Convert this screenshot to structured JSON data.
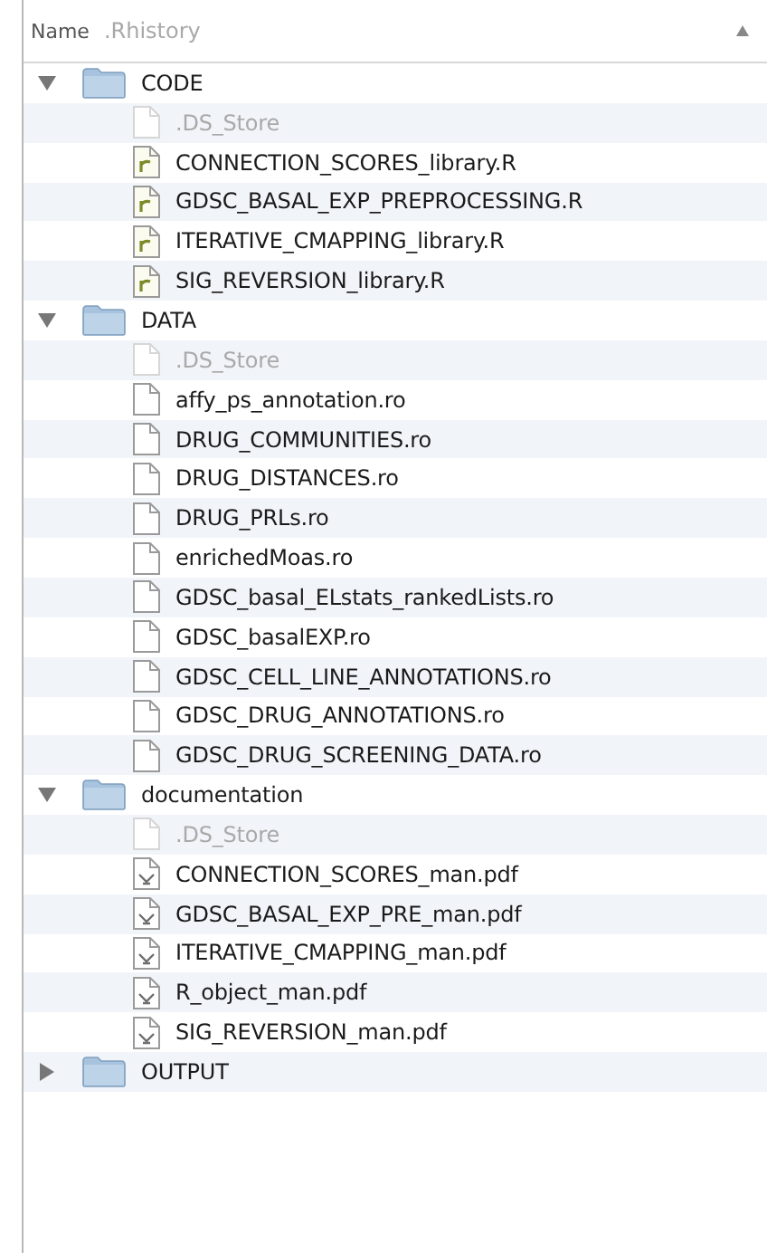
{
  "header": {
    "column": "Name",
    "ghost": ".Rhistory"
  },
  "tree": [
    {
      "name": "CODE",
      "kind": "folder",
      "expanded": true,
      "dimmed": false,
      "children": [
        {
          "name": ".DS_Store",
          "kind": "blank",
          "dimmed": true
        },
        {
          "name": "CONNECTION_SCORES_library.R",
          "kind": "r-script",
          "dimmed": false
        },
        {
          "name": "GDSC_BASAL_EXP_PREPROCESSING.R",
          "kind": "r-script",
          "dimmed": false
        },
        {
          "name": "ITERATIVE_CMAPPING_library.R",
          "kind": "r-script",
          "dimmed": false
        },
        {
          "name": "SIG_REVERSION_library.R",
          "kind": "r-script",
          "dimmed": false
        }
      ]
    },
    {
      "name": "DATA",
      "kind": "folder",
      "expanded": true,
      "dimmed": false,
      "children": [
        {
          "name": ".DS_Store",
          "kind": "blank",
          "dimmed": true
        },
        {
          "name": "affy_ps_annotation.ro",
          "kind": "blank",
          "dimmed": false
        },
        {
          "name": "DRUG_COMMUNITIES.ro",
          "kind": "blank",
          "dimmed": false
        },
        {
          "name": "DRUG_DISTANCES.ro",
          "kind": "blank",
          "dimmed": false
        },
        {
          "name": "DRUG_PRLs.ro",
          "kind": "blank",
          "dimmed": false
        },
        {
          "name": "enrichedMoas.ro",
          "kind": "blank",
          "dimmed": false
        },
        {
          "name": "GDSC_basal_ELstats_rankedLists.ro",
          "kind": "blank",
          "dimmed": false
        },
        {
          "name": "GDSC_basalEXP.ro",
          "kind": "blank",
          "dimmed": false
        },
        {
          "name": "GDSC_CELL_LINE_ANNOTATIONS.ro",
          "kind": "blank",
          "dimmed": false
        },
        {
          "name": "GDSC_DRUG_ANNOTATIONS.ro",
          "kind": "blank",
          "dimmed": false
        },
        {
          "name": "GDSC_DRUG_SCREENING_DATA.ro",
          "kind": "blank",
          "dimmed": false
        }
      ]
    },
    {
      "name": "documentation",
      "kind": "folder",
      "expanded": true,
      "dimmed": false,
      "children": [
        {
          "name": ".DS_Store",
          "kind": "blank",
          "dimmed": true
        },
        {
          "name": "CONNECTION_SCORES_man.pdf",
          "kind": "pdf",
          "dimmed": false
        },
        {
          "name": "GDSC_BASAL_EXP_PRE_man.pdf",
          "kind": "pdf",
          "dimmed": false
        },
        {
          "name": "ITERATIVE_CMAPPING_man.pdf",
          "kind": "pdf",
          "dimmed": false
        },
        {
          "name": "R_object_man.pdf",
          "kind": "pdf",
          "dimmed": false
        },
        {
          "name": "SIG_REVERSION_man.pdf",
          "kind": "pdf",
          "dimmed": false
        }
      ]
    },
    {
      "name": "OUTPUT",
      "kind": "folder",
      "expanded": false,
      "dimmed": false
    }
  ]
}
